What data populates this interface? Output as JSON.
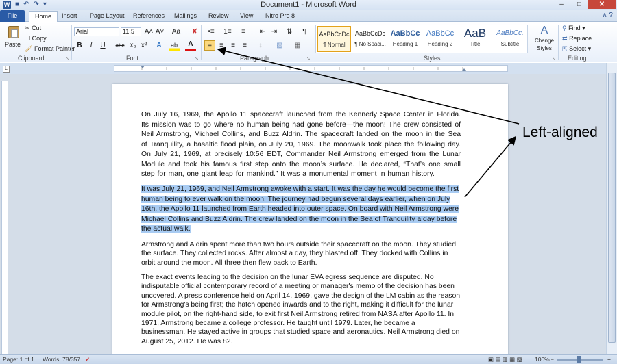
{
  "window": {
    "title": "Document1 - Microsoft Word",
    "controls": {
      "minimize": "–",
      "maximize": "□",
      "close": "✕"
    }
  },
  "qat": {
    "app_icon": "W",
    "save": "■",
    "undo": "↶",
    "redo": "↷",
    "customize": "▾"
  },
  "tabs": [
    "File",
    "Home",
    "Insert",
    "Page Layout",
    "References",
    "Mailings",
    "Review",
    "View",
    "Nitro Pro 8"
  ],
  "active_tab": "Home",
  "ribbon_help": "∧ ?",
  "clipboard": {
    "label": "Clipboard",
    "paste": "Paste",
    "cut": "Cut",
    "copy": "Copy",
    "format_painter": "Format Painter"
  },
  "font": {
    "label": "Font",
    "family": "Arial",
    "size": "11.5",
    "bold": "B",
    "italic": "I",
    "underline": "U",
    "strike": "abc",
    "subscript": "x₂",
    "superscript": "x²",
    "grow": "A˄",
    "shrink": "A˅",
    "change_case": "Aa",
    "clear": "✘",
    "text_effects": "A",
    "highlight": "ab",
    "font_color": "A"
  },
  "paragraph": {
    "label": "Paragraph",
    "bullets": "•≡",
    "numbering": "1≡",
    "multilevel": "≡",
    "decrease_indent": "⇤",
    "increase_indent": "⇥",
    "sort": "⇅",
    "show_marks": "¶",
    "align_left": "≡",
    "align_center": "≡",
    "align_right": "≡",
    "justify": "≡",
    "line_spacing": "↕",
    "shading": "▧",
    "borders": "▦"
  },
  "styles": {
    "label": "Styles",
    "items": [
      {
        "sample": "AaBbCcDc",
        "name": "¶ Normal"
      },
      {
        "sample": "AaBbCcDc",
        "name": "¶ No Spaci..."
      },
      {
        "sample": "AaBbCc",
        "name": "Heading 1"
      },
      {
        "sample": "AaBbCc",
        "name": "Heading 2"
      },
      {
        "sample": "AaB",
        "name": "Title"
      },
      {
        "sample": "AaBbCc.",
        "name": "Subtitle"
      }
    ],
    "change_styles": "Change Styles"
  },
  "editing": {
    "label": "Editing",
    "find": "Find",
    "replace": "Replace",
    "select": "Select"
  },
  "document": {
    "p1": "On July 16, 1969, the Apollo 11 spacecraft launched from the Kennedy Space Center in Florida. Its mission was to go where no human being had gone before—the moon! The crew consisted of Neil Armstrong, Michael Collins, and Buzz Aldrin. The spacecraft landed on the moon in the Sea of Tranquility, a basaltic flood plain, on July 20, 1969. The moonwalk took place the following day. On July 21, 1969, at precisely 10:56 EDT, Commander Neil Armstrong emerged from the Lunar Module and took his famous first step onto the moon’s surface. He declared, “That’s one small step for man, one giant leap for mankind.” It was a monumental moment in human history.",
    "p2": "It was July 21, 1969, and Neil Armstrong awoke with a start. It was the day he would become the first human being to ever walk on the moon. The journey had begun several days earlier, when on July 16th, the Apollo 11 launched from Earth headed into outer space. On board with Neil Armstrong were Michael Collins and Buzz Aldrin. The crew landed on the moon in the Sea of Tranquility a day before the actual walk.",
    "p3": "Armstrong and Aldrin spent more than two hours outside their spacecraft on the moon. They studied the surface. They collected rocks. After almost a day, they blasted off. They docked with Collins in orbit around the moon. All three then flew back to Earth.",
    "p4": "The exact events leading to the decision on the lunar EVA egress sequence are disputed. No indisputable official contemporary record of a meeting or manager's memo of the decision has been uncovered. A press conference held on April 14, 1969, gave the design of the LM cabin as the reason for Armstrong's being first; the hatch opened inwards and to the right, making it difficult for the lunar module pilot, on the right-hand side, to exit first Neil Armstrong retired from NASA after Apollo 11. In 1971, Armstrong became a college professor. He taught until 1979. Later, he became a businessman. He stayed active in groups that studied space and aeronautics. Neil Armstrong died on August 25, 2012. He was 82."
  },
  "annotation": {
    "label": "Left-aligned"
  },
  "status": {
    "page": "Page: 1 of 1",
    "words": "Words: 78/357",
    "zoom": "100%",
    "zoom_out": "−",
    "zoom_in": "+"
  }
}
